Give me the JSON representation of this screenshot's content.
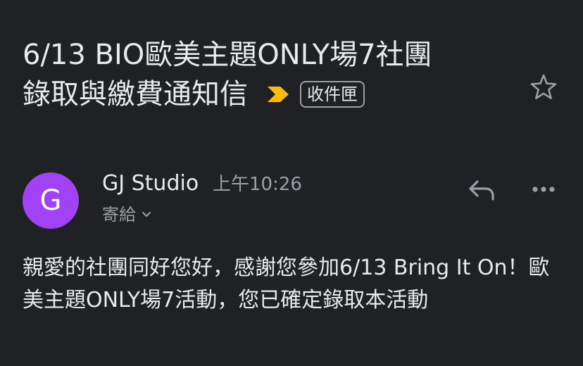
{
  "email": {
    "subject_line1": "6/13 BIO歐美主題ONLY場7社團",
    "subject_line2": "錄取與繳費通知信",
    "label": "收件匣",
    "sender": {
      "initial": "G",
      "name": "GJ Studio",
      "time": "上午10:26",
      "to_label": "寄給"
    },
    "body": "親愛的社團同好您好，感謝您參加6/13 Bring It On！歐美主題ONLY場7活動，您已確定錄取本活動"
  },
  "icons": {
    "importance": "importance-marker-icon",
    "star": "star-icon",
    "reply": "reply-icon",
    "more": "more-horizontal-icon",
    "chevron": "chevron-down-icon"
  },
  "colors": {
    "background": "#202124",
    "text": "#e8eaed",
    "secondary": "#9aa0a6",
    "importance": "#fbbc04",
    "avatar": "#a142f4"
  }
}
